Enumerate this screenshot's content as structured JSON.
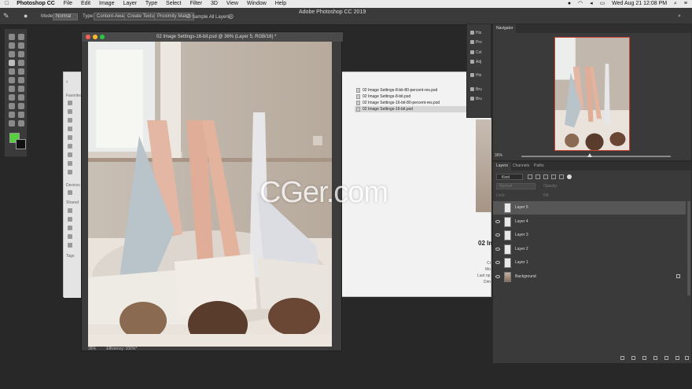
{
  "menubar": {
    "app_name": "Photoshop CC",
    "items": [
      "File",
      "Edit",
      "Image",
      "Layer",
      "Type",
      "Select",
      "Filter",
      "3D",
      "View",
      "Window",
      "Help"
    ],
    "clock": "Wed Aug 21  12:08 PM"
  },
  "window_title": "Adobe Photoshop CC 2019",
  "options_bar": {
    "mode_label": "Mode:",
    "mode_value": "Normal",
    "type_label": "Type:",
    "content_aware": "Content-Aware",
    "create_texture": "Create Texture",
    "proximity_match": "Proximity Match",
    "sample_all_layers": "Sample All Layers"
  },
  "colors": {
    "foreground": "#57d03e",
    "background": "#111111",
    "selection_frame": "#cc4433"
  },
  "document": {
    "title": "02 Image Settings-16-bit.psd @ 36% (Layer 5, RGB/16) *",
    "zoom": "36%",
    "status": "Efficiency: 100%*"
  },
  "finder": {
    "sidebar_favorites": "Favorites",
    "sidebar_devices": "Devices",
    "sidebar_shared": "Shared",
    "sidebar_tags": "Tags",
    "files": [
      "02 Image Settings-8-bit-80-percent-res.psd",
      "02 Image Settings-8-bit.psd",
      "02 Image Settings-16-bit-80-percent-res.psd",
      "02 Image Settings-16-bit.psd"
    ],
    "selected_index": 3,
    "preview_title": "02 Im",
    "meta": [
      "Cr",
      "Mo",
      "Last op",
      "Dim"
    ]
  },
  "panel_icons": [
    "His",
    "Pro",
    "Col",
    "Adj",
    "His",
    "Bru",
    "Bru"
  ],
  "navigator": {
    "tab": "Navigator",
    "zoom": "36%"
  },
  "layers_panel": {
    "tabs": [
      "Layers",
      "Channels",
      "Paths"
    ],
    "kind_label": "Kind",
    "blend_mode": "Normal",
    "opacity_label": "Opacity:",
    "lock_label": "Lock:",
    "fill_label": "Fill:",
    "layers": [
      {
        "name": "Layer 5",
        "visible": false,
        "selected": true
      },
      {
        "name": "Layer 4",
        "visible": true,
        "selected": false
      },
      {
        "name": "Layer 3",
        "visible": true,
        "selected": false
      },
      {
        "name": "Layer 2",
        "visible": true,
        "selected": false
      },
      {
        "name": "Layer 1",
        "visible": true,
        "selected": false
      },
      {
        "name": "Background",
        "visible": true,
        "selected": false,
        "locked": true
      }
    ]
  },
  "watermark": "CGer.com"
}
